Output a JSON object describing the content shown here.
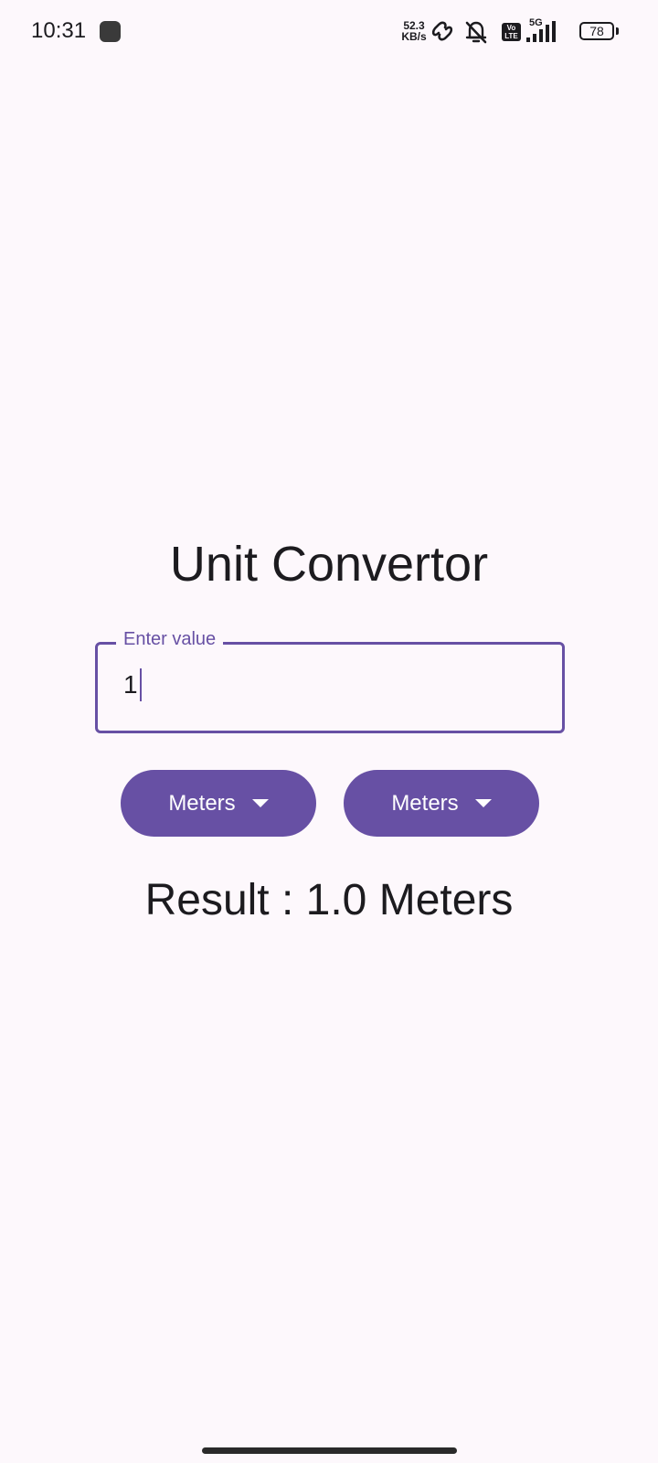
{
  "status_bar": {
    "time": "10:31",
    "net_speed_value": "52.3",
    "net_speed_unit": "KB/s",
    "volte_line1": "Vo",
    "volte_line2": "LTE",
    "network_type": "5G",
    "battery_level": "78",
    "icons": [
      "app-notification-icon",
      "hotspot-link-icon",
      "bell-off-icon",
      "volte-icon",
      "signal-strength-icon",
      "battery-icon"
    ]
  },
  "main": {
    "title": "Unit Convertor",
    "input": {
      "label": "Enter value",
      "value": "1"
    },
    "from_unit": {
      "label": "Meters",
      "icon": "dropdown-arrow-icon"
    },
    "to_unit": {
      "label": "Meters",
      "icon": "dropdown-arrow-icon"
    },
    "result": "Result : 1.0 Meters"
  },
  "colors": {
    "primary": "#6750a4",
    "background": "#fdf8fc",
    "text": "#1c1b1f",
    "on_primary": "#ffffff"
  }
}
